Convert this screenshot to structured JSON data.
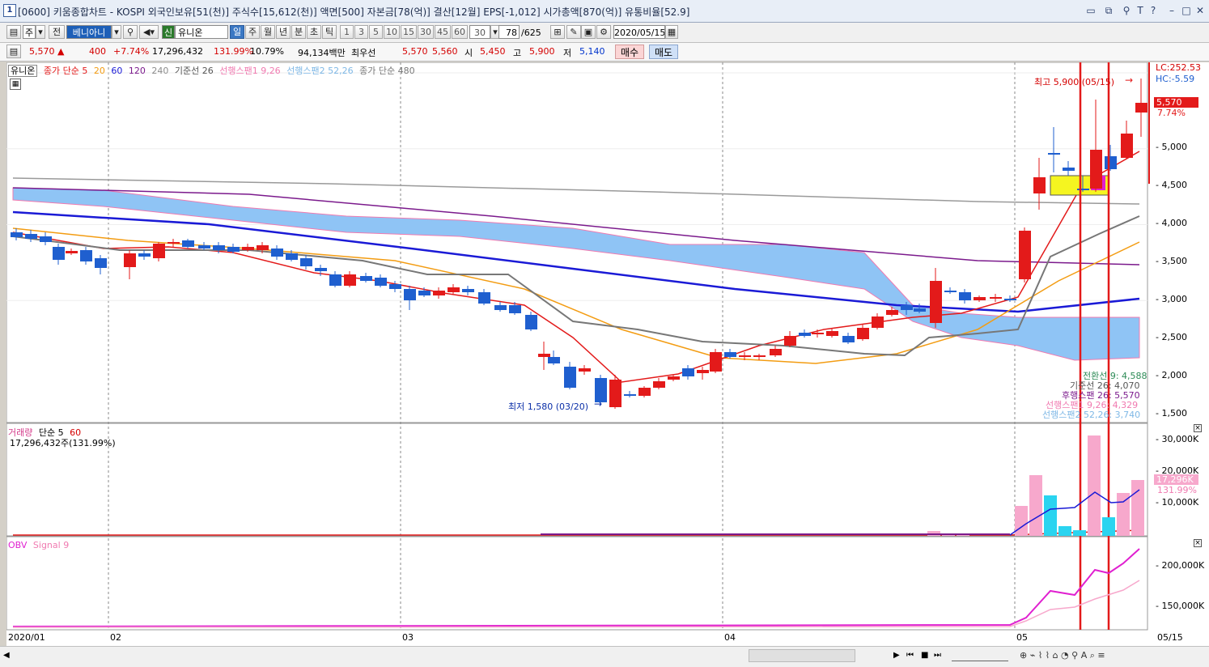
{
  "title_bar": {
    "window_number": "1",
    "title": "[0600] 키움종합차트 - KOSPI 외국인보유[51(천)] 주식수[15,612(천)] 액면[500] 자본금[78(억)] 결산[12월] EPS[-1,012] 시가총액[870(억)] 유통비율[52.9]"
  },
  "toolbar": {
    "type_label": "주",
    "all_label": "전",
    "code": "베니아니",
    "stock_badge": "신",
    "stock_name": "유니온",
    "periods": [
      "일",
      "주",
      "월",
      "년",
      "분",
      "초",
      "틱"
    ],
    "intervals": [
      "1",
      "3",
      "5",
      "10",
      "15",
      "30",
      "45",
      "60"
    ],
    "interval_value": "30",
    "count": "78",
    "count_total": "/625",
    "date": "2020/05/15"
  },
  "quote": {
    "price": "5,570",
    "change": "400",
    "change_pct": "+7.74%",
    "volume": "17,296,432",
    "volume_ratio": "131.99%",
    "turnover": "10.79%",
    "amount": "94,134백만",
    "pref_label": "최우선",
    "ask": "5,570",
    "bid": "5,560",
    "open_label": "시",
    "open": "5,450",
    "high_label": "고",
    "high": "5,900",
    "low_label": "저",
    "low": "5,140",
    "buy_label": "매수",
    "sell_label": "매도"
  },
  "legend": {
    "stock": "유니온",
    "ma_label": "종가 단순 5",
    "ma20": "20",
    "ma60": "60",
    "ma120": "120",
    "ma240": "240",
    "base_line": "기준선 26",
    "span1": "선행스팬1 9,26",
    "span2": "선행스팬2 52,26",
    "ma480": "종가 단순 480"
  },
  "price_axis": [
    "5,000",
    "4,500",
    "4,000",
    "3,500",
    "3,000",
    "2,500",
    "2,000",
    "1,500"
  ],
  "price_tags": {
    "lc": "LC:252.53",
    "hc": "HC:-5.59",
    "current": "5,570",
    "current_pct": "7.74%"
  },
  "annotations": {
    "high": "최고 5,900 (05/15)",
    "low": "최저 1,580 (03/20)",
    "info_lines": [
      "전환선 9: 4,588",
      "기준선 26: 4,070",
      "후행스팬 26: 5,570",
      "선행스팬1 9,26: 4,329",
      "선행스팬2 52,26: 3,740"
    ]
  },
  "volume_panel": {
    "legend_name": "거래량",
    "legend_ma": "단순 5",
    "legend_ma60": "60",
    "value": "17,296,432주(131.99%)",
    "axis": [
      "30,000K",
      "20,000K",
      "10,000K"
    ],
    "tag_value": "17,296K",
    "tag_pct": "131.99%"
  },
  "obv_panel": {
    "legend_name": "OBV",
    "legend_signal": "Signal 9",
    "axis": [
      "200,000K",
      "150,000K"
    ]
  },
  "date_axis": [
    "2020/01",
    "02",
    "03",
    "04",
    "05",
    "05/15"
  ],
  "colors": {
    "up": "#e31a1a",
    "down": "#1f5fcf",
    "ma5": "#e31a1a",
    "ma20": "#f39c12",
    "ma60": "#1a1ad6",
    "ma120": "#7b1a8c",
    "ma240": "#8c8c8c",
    "cloud": "#8fc4f5"
  }
}
